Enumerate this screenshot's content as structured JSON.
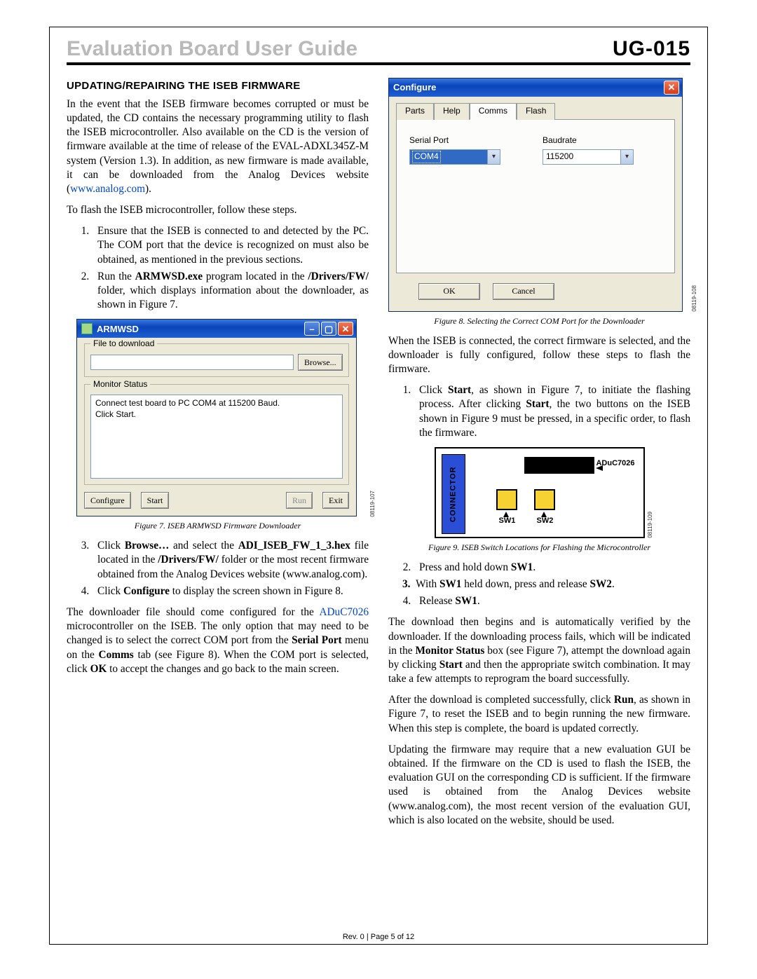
{
  "header": {
    "title_light": "Evaluation Board ",
    "title_strong": "User Guide",
    "code": "UG-015"
  },
  "section_title": "UPDATING/REPAIRING THE ISEB FIRMWARE",
  "p_intro": "In the event that the ISEB firmware becomes corrupted or must be updated, the CD contains the necessary programming utility to flash the ISEB microcontroller. Also available on the CD is the version of firmware available at the time of release of the EVAL-ADXL345Z-M system (Version 1.3). In addition, as new firmware is made available, it can be downloaded from the Analog Devices website (",
  "intro_link": "www.analog.com",
  "p_intro_tail": ").",
  "p_flash_lead": "To flash the ISEB microcontroller, follow these steps.",
  "steps_a": [
    "Ensure that the ISEB is connected to and detected by the PC. The COM port that the device is recognized on must also be obtained, as mentioned in the previous sections.",
    "Run the <b>ARMWSD.exe</b> program located in the <b>/Drivers/FW/</b> folder, which displays information about the downloader, as shown in Figure 7."
  ],
  "fig7": {
    "title": "ARMWSD",
    "group_file": "File to download",
    "browse": "Browse...",
    "group_monitor": "Monitor Status",
    "status_text": "Connect test board to PC COM4 at 115200 Baud.\nClick Start.",
    "btn_configure": "Configure",
    "btn_start": "Start",
    "btn_run": "Run",
    "btn_exit": "Exit",
    "id": "08119-107",
    "caption": "Figure 7. ISEB ARMWSD Firmware Downloader"
  },
  "steps_b": [
    "Click <b>Browse…</b> and select the <b>ADI_ISEB_FW_1_3.hex</b> file located in the <b>/Drivers/FW/</b> folder or the most recent firmware obtained from the Analog Devices website (www.analog.com).",
    "Click <b>Configure</b> to display the screen shown in Figure 8."
  ],
  "p_downloader": "The downloader file should come configured for the ",
  "aduc_link": "ADuC7026",
  "p_downloader_tail": " microcontroller on the ISEB. The only option that may need to be changed is to select the correct COM port from the <b>Serial Port</b> menu on the <b>Comms</b> tab (see Figure 8). When the COM port is selected, click <b>OK</b> to accept the changes and go back to the main screen.",
  "fig8": {
    "title": "Configure",
    "tabs": [
      "Parts",
      "Help",
      "Comms",
      "Flash"
    ],
    "active_tab": 2,
    "serial_label": "Serial Port",
    "serial_value": "COM4",
    "baud_label": "Baudrate",
    "baud_value": "115200",
    "ok": "OK",
    "cancel": "Cancel",
    "id": "08119-108",
    "caption": "Figure 8. Selecting the Correct COM Port for the Downloader"
  },
  "p_connected": "When the ISEB is connected, the correct firmware is selected, and the downloader is fully configured, follow these steps to flash the firmware.",
  "steps_c": [
    "Click <b>Start</b>, as shown in Figure 7, to initiate the flashing process. After clicking <b>Start</b>, the two buttons on the ISEB shown in Figure 9 must be pressed, in a specific order, to flash the firmware."
  ],
  "fig9": {
    "connector": "CONNECTOR",
    "chip": "ADuC7026",
    "sw1": "SW1",
    "sw2": "SW2",
    "id": "08119-109",
    "caption": "Figure 9. ISEB Switch Locations for Flashing the Microcontroller"
  },
  "steps_d": [
    "Press and hold down <b>SW1</b>.",
    "With <b>SW1</b> held down, press and release <b>SW2</b>.",
    "Release <b>SW1</b>."
  ],
  "p_download_then": "The download then begins and is automatically verified by the downloader. If the downloading process fails, which will be indicated in the <b>Monitor Status</b> box (see Figure 7), attempt the download again by clicking <b>Start</b> and then the appropriate switch combination. It may take a few attempts to reprogram the board successfully.",
  "p_after_run": "After the download is completed successfully, click <b>Run</b>, as shown in Figure 7, to reset the ISEB and to begin running the new firmware. When this step is complete, the board is updated correctly.",
  "p_updating_gui": "Updating the firmware may require that a new evaluation GUI be obtained. If the firmware on the CD is used to flash the ISEB, the evaluation GUI on the corresponding CD is sufficient. If the firmware used is obtained from the Analog Devices website (www.analog.com), the most recent version of the evaluation GUI, which is also located on the website, should be used.",
  "footer": "Rev. 0 | Page 5 of 12"
}
